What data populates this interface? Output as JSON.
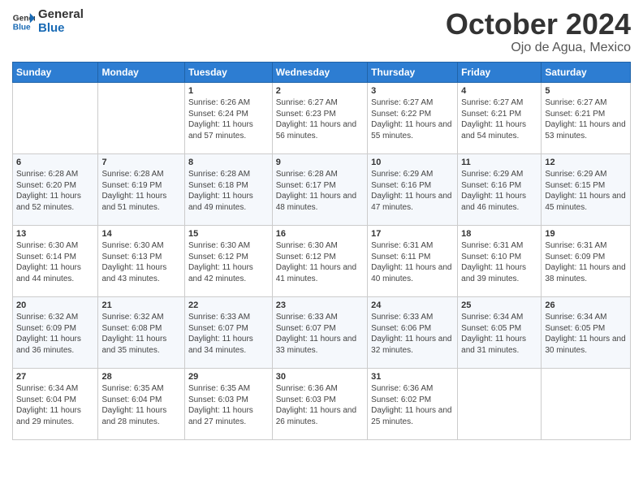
{
  "logo": {
    "line1": "General",
    "line2": "Blue"
  },
  "title": "October 2024",
  "subtitle": "Ojo de Agua, Mexico",
  "weekdays": [
    "Sunday",
    "Monday",
    "Tuesday",
    "Wednesday",
    "Thursday",
    "Friday",
    "Saturday"
  ],
  "weeks": [
    [
      {
        "num": "",
        "info": ""
      },
      {
        "num": "",
        "info": ""
      },
      {
        "num": "1",
        "info": "Sunrise: 6:26 AM\nSunset: 6:24 PM\nDaylight: 11 hours and 57 minutes."
      },
      {
        "num": "2",
        "info": "Sunrise: 6:27 AM\nSunset: 6:23 PM\nDaylight: 11 hours and 56 minutes."
      },
      {
        "num": "3",
        "info": "Sunrise: 6:27 AM\nSunset: 6:22 PM\nDaylight: 11 hours and 55 minutes."
      },
      {
        "num": "4",
        "info": "Sunrise: 6:27 AM\nSunset: 6:21 PM\nDaylight: 11 hours and 54 minutes."
      },
      {
        "num": "5",
        "info": "Sunrise: 6:27 AM\nSunset: 6:21 PM\nDaylight: 11 hours and 53 minutes."
      }
    ],
    [
      {
        "num": "6",
        "info": "Sunrise: 6:28 AM\nSunset: 6:20 PM\nDaylight: 11 hours and 52 minutes."
      },
      {
        "num": "7",
        "info": "Sunrise: 6:28 AM\nSunset: 6:19 PM\nDaylight: 11 hours and 51 minutes."
      },
      {
        "num": "8",
        "info": "Sunrise: 6:28 AM\nSunset: 6:18 PM\nDaylight: 11 hours and 49 minutes."
      },
      {
        "num": "9",
        "info": "Sunrise: 6:28 AM\nSunset: 6:17 PM\nDaylight: 11 hours and 48 minutes."
      },
      {
        "num": "10",
        "info": "Sunrise: 6:29 AM\nSunset: 6:16 PM\nDaylight: 11 hours and 47 minutes."
      },
      {
        "num": "11",
        "info": "Sunrise: 6:29 AM\nSunset: 6:16 PM\nDaylight: 11 hours and 46 minutes."
      },
      {
        "num": "12",
        "info": "Sunrise: 6:29 AM\nSunset: 6:15 PM\nDaylight: 11 hours and 45 minutes."
      }
    ],
    [
      {
        "num": "13",
        "info": "Sunrise: 6:30 AM\nSunset: 6:14 PM\nDaylight: 11 hours and 44 minutes."
      },
      {
        "num": "14",
        "info": "Sunrise: 6:30 AM\nSunset: 6:13 PM\nDaylight: 11 hours and 43 minutes."
      },
      {
        "num": "15",
        "info": "Sunrise: 6:30 AM\nSunset: 6:12 PM\nDaylight: 11 hours and 42 minutes."
      },
      {
        "num": "16",
        "info": "Sunrise: 6:30 AM\nSunset: 6:12 PM\nDaylight: 11 hours and 41 minutes."
      },
      {
        "num": "17",
        "info": "Sunrise: 6:31 AM\nSunset: 6:11 PM\nDaylight: 11 hours and 40 minutes."
      },
      {
        "num": "18",
        "info": "Sunrise: 6:31 AM\nSunset: 6:10 PM\nDaylight: 11 hours and 39 minutes."
      },
      {
        "num": "19",
        "info": "Sunrise: 6:31 AM\nSunset: 6:09 PM\nDaylight: 11 hours and 38 minutes."
      }
    ],
    [
      {
        "num": "20",
        "info": "Sunrise: 6:32 AM\nSunset: 6:09 PM\nDaylight: 11 hours and 36 minutes."
      },
      {
        "num": "21",
        "info": "Sunrise: 6:32 AM\nSunset: 6:08 PM\nDaylight: 11 hours and 35 minutes."
      },
      {
        "num": "22",
        "info": "Sunrise: 6:33 AM\nSunset: 6:07 PM\nDaylight: 11 hours and 34 minutes."
      },
      {
        "num": "23",
        "info": "Sunrise: 6:33 AM\nSunset: 6:07 PM\nDaylight: 11 hours and 33 minutes."
      },
      {
        "num": "24",
        "info": "Sunrise: 6:33 AM\nSunset: 6:06 PM\nDaylight: 11 hours and 32 minutes."
      },
      {
        "num": "25",
        "info": "Sunrise: 6:34 AM\nSunset: 6:05 PM\nDaylight: 11 hours and 31 minutes."
      },
      {
        "num": "26",
        "info": "Sunrise: 6:34 AM\nSunset: 6:05 PM\nDaylight: 11 hours and 30 minutes."
      }
    ],
    [
      {
        "num": "27",
        "info": "Sunrise: 6:34 AM\nSunset: 6:04 PM\nDaylight: 11 hours and 29 minutes."
      },
      {
        "num": "28",
        "info": "Sunrise: 6:35 AM\nSunset: 6:04 PM\nDaylight: 11 hours and 28 minutes."
      },
      {
        "num": "29",
        "info": "Sunrise: 6:35 AM\nSunset: 6:03 PM\nDaylight: 11 hours and 27 minutes."
      },
      {
        "num": "30",
        "info": "Sunrise: 6:36 AM\nSunset: 6:03 PM\nDaylight: 11 hours and 26 minutes."
      },
      {
        "num": "31",
        "info": "Sunrise: 6:36 AM\nSunset: 6:02 PM\nDaylight: 11 hours and 25 minutes."
      },
      {
        "num": "",
        "info": ""
      },
      {
        "num": "",
        "info": ""
      }
    ]
  ]
}
